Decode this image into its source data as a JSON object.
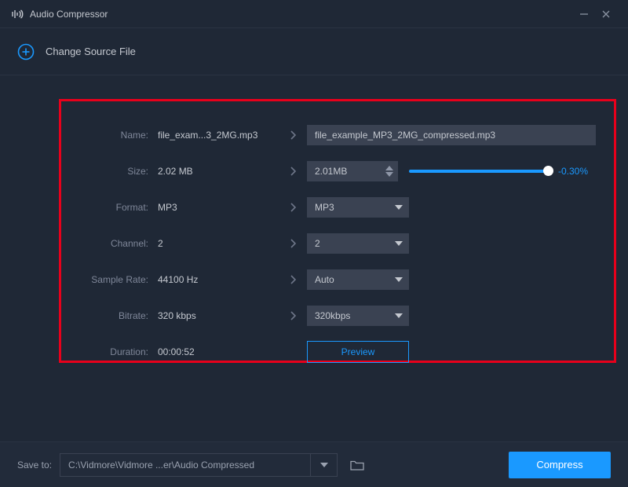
{
  "titlebar": {
    "app_name": "Audio Compressor"
  },
  "changerow": {
    "label": "Change Source File"
  },
  "panel": {
    "labels": {
      "name": "Name:",
      "size": "Size:",
      "format": "Format:",
      "channel": "Channel:",
      "sample_rate": "Sample Rate:",
      "bitrate": "Bitrate:",
      "duration": "Duration:"
    },
    "src": {
      "name": "file_exam...3_2MG.mp3",
      "size": "2.02 MB",
      "format": "MP3",
      "channel": "2",
      "sample_rate": "44100 Hz",
      "bitrate": "320 kbps",
      "duration": "00:00:52"
    },
    "out": {
      "name": "file_example_MP3_2MG_compressed.mp3",
      "size": "2.01MB",
      "format": "MP3",
      "channel": "2",
      "sample_rate": "Auto",
      "bitrate": "320kbps"
    },
    "size_reduction_pct": "-0.30%",
    "preview_label": "Preview"
  },
  "bottombar": {
    "saveto_label": "Save to:",
    "path": "C:\\Vidmore\\Vidmore ...er\\Audio Compressed",
    "compress_label": "Compress"
  }
}
